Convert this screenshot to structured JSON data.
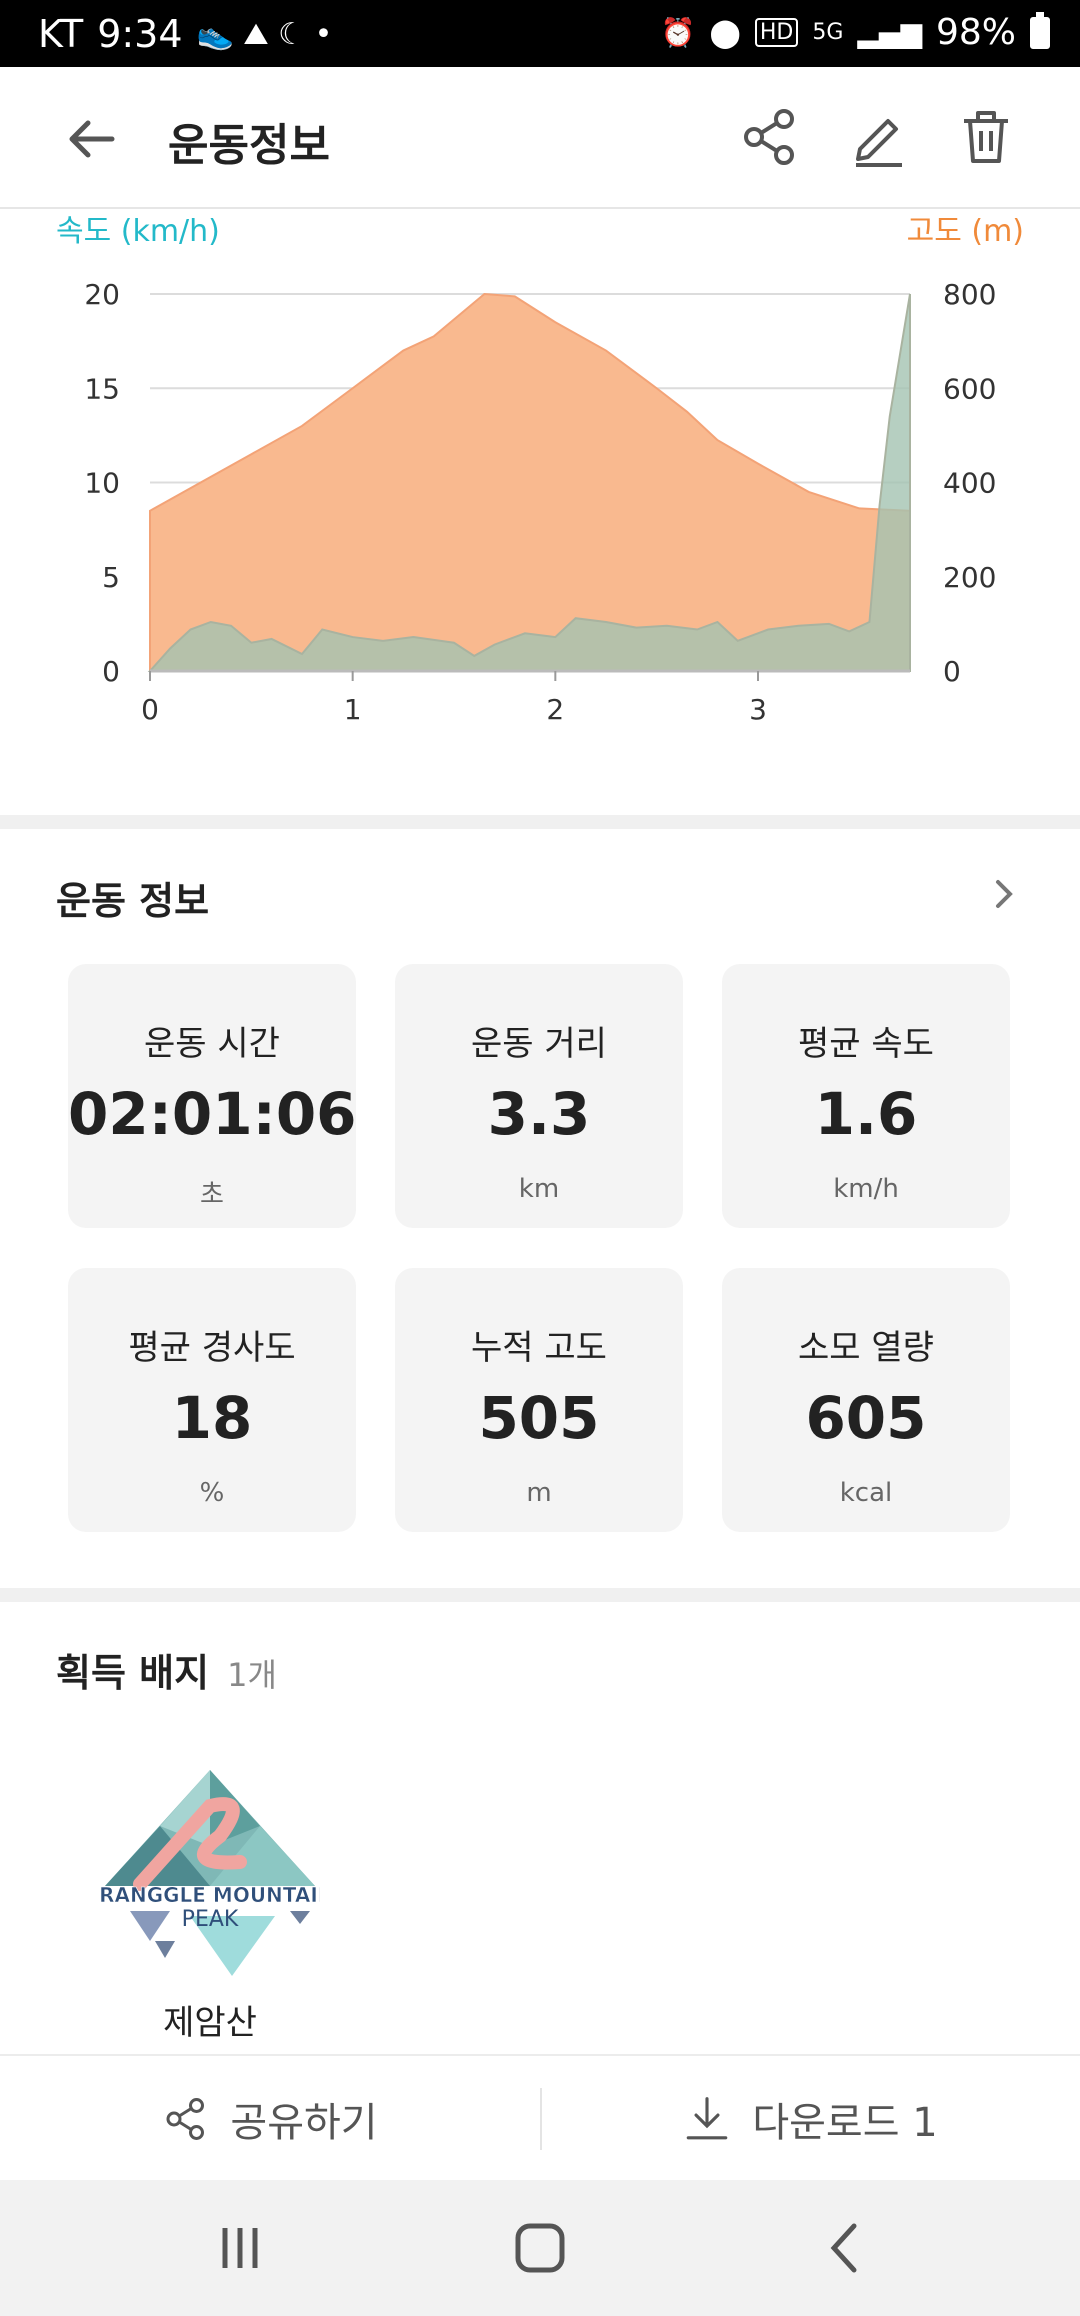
{
  "status_bar": {
    "carrier": "KT",
    "time": "9:34",
    "network": "5G",
    "battery": "98%"
  },
  "header": {
    "title": "운동정보"
  },
  "chart_data": {
    "type": "area",
    "x_ticks": [
      "0",
      "1",
      "2",
      "3"
    ],
    "y_left_label": "속도 (km/h)",
    "y_right_label": "고도 (m)",
    "y_left_ticks": [
      "0",
      "5",
      "10",
      "15",
      "20"
    ],
    "y_right_ticks": [
      "0",
      "200",
      "400",
      "600",
      "800"
    ],
    "y_left_range": [
      0,
      20
    ],
    "y_right_range": [
      0,
      800
    ],
    "x_range": [
      0,
      3.75
    ],
    "grid": true,
    "altitude_color": "#f9b98f",
    "speed_color": "#5fd3dd",
    "overlap_color": "#c2bb9f",
    "series": [
      {
        "unit": "m",
        "axis": "right",
        "x": [
          0,
          0.25,
          0.5,
          0.75,
          1.0,
          1.25,
          1.4,
          1.65,
          1.8,
          2.0,
          2.25,
          2.5,
          2.65,
          2.8,
          3.0,
          3.25,
          3.5,
          3.75
        ],
        "values": [
          340,
          400,
          460,
          520,
          600,
          680,
          710,
          800,
          795,
          740,
          680,
          600,
          550,
          490,
          440,
          380,
          345,
          340
        ]
      },
      {
        "unit": "km/h",
        "axis": "left",
        "x": [
          0,
          0.1,
          0.2,
          0.3,
          0.4,
          0.5,
          0.6,
          0.75,
          0.85,
          1.0,
          1.15,
          1.3,
          1.5,
          1.6,
          1.7,
          1.85,
          2.0,
          2.1,
          2.25,
          2.4,
          2.55,
          2.7,
          2.8,
          2.9,
          3.05,
          3.2,
          3.35,
          3.45,
          3.55,
          3.6,
          3.65,
          3.75
        ],
        "values": [
          0,
          1.2,
          2.2,
          2.6,
          2.4,
          1.5,
          1.7,
          0.9,
          2.2,
          1.8,
          1.6,
          1.8,
          1.5,
          0.8,
          1.4,
          2.0,
          1.8,
          2.8,
          2.6,
          2.3,
          2.4,
          2.2,
          2.6,
          1.6,
          2.2,
          2.4,
          2.5,
          2.1,
          2.6,
          8.8,
          13.5,
          20
        ]
      }
    ]
  },
  "workout_section": {
    "title": "운동 정보",
    "cards": [
      {
        "label": "운동 시간",
        "value": "02:01:06",
        "unit": "초"
      },
      {
        "label": "운동 거리",
        "value": "3.3",
        "unit": "km"
      },
      {
        "label": "평균 속도",
        "value": "1.6",
        "unit": "km/h"
      },
      {
        "label": "평균 경사도",
        "value": "18",
        "unit": "%"
      },
      {
        "label": "누적 고도",
        "value": "505",
        "unit": "m"
      },
      {
        "label": "소모 열량",
        "value": "605",
        "unit": "kcal"
      }
    ]
  },
  "badges": {
    "title": "획득 배지",
    "count": "1개",
    "items": [
      {
        "name": "제암산",
        "logo_text_1": "TRANGGLE MOUNTAIN",
        "logo_text_2": "PEAK"
      }
    ]
  },
  "actions": {
    "share_label": "공유하기",
    "download_label": "다운로드 1"
  },
  "icons": {
    "back": "arrow-left-icon",
    "share": "share-icon",
    "edit": "pencil-icon",
    "delete": "trash-icon"
  }
}
